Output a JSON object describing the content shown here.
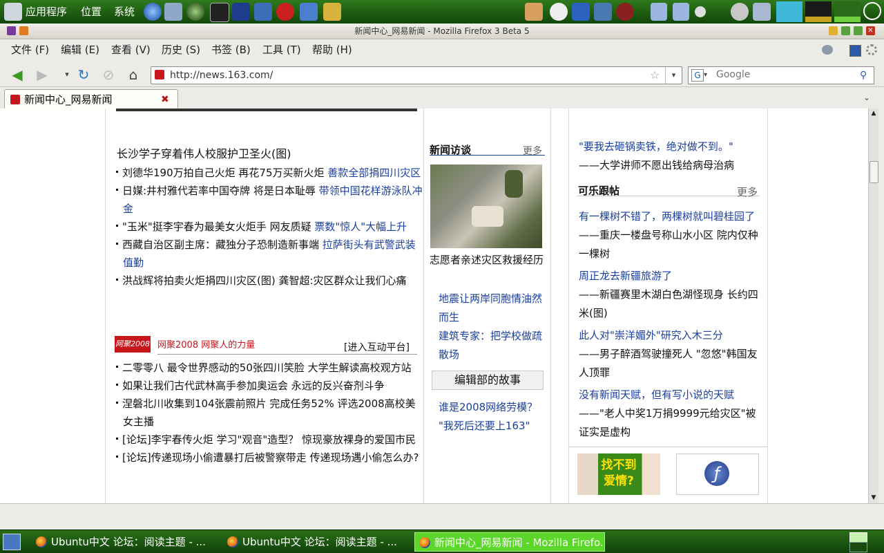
{
  "top_panel": {
    "menus": [
      "应用程序",
      "位置",
      "系统"
    ]
  },
  "window": {
    "title": "新闻中心_网易新闻 - Mozilla Firefox 3 Beta 5"
  },
  "menubar": [
    "文件 (F)",
    "编辑 (E)",
    "查看 (V)",
    "历史 (S)",
    "书签 (B)",
    "工具 (T)",
    "帮助 (H)"
  ],
  "navbar": {
    "url": "http://news.163.com/",
    "search_placeholder": "Google"
  },
  "tab": {
    "label": "新闻中心_网易新闻",
    "close": "✖"
  },
  "left_col": {
    "headline": "长沙学子穿着伟人校服护卫圣火(图)",
    "items": [
      {
        "text": "刘德华190万拍自己火炬 再花75万买新火炬 ",
        "link": "善款全部捐四川灾区"
      },
      {
        "text": "日媒:井村雅代若率中国夺牌 将是日本耻辱 ",
        "link": "带领中国花样游泳队冲金"
      },
      {
        "text": "\"玉米\"挺李宇春为最美女火炬手 网友质疑 ",
        "link": "票数\"惊人\"大幅上升"
      },
      {
        "text": "西藏自治区副主席：藏独分子恐制造新事端 ",
        "link": "拉萨街头有武警武装值勤"
      },
      {
        "text": "洪战辉将拍卖火炬捐四川灾区(图) 龚智超:灾区群众让我们心痛",
        "link": ""
      }
    ],
    "banner_logo": "网聚2008",
    "banner_text": "网聚2008  网聚人的力量",
    "banner_link": "[进入互动平台]",
    "items2": [
      "二零零八 最令世界感动的50张四川笑脸 大学生解读高校观方站",
      "如果让我们古代武林高手参加奥运会 永远的反兴奋剂斗争",
      "涅磐北川收集到104张震前照片 完成任务52% 评选2008高校美女主播",
      "[论坛]李宇春传火炬 学习\"观音\"造型？ 惊现豪放裸身的爱国市民",
      "[论坛]传递现场小偷遭暴打后被警察带走 传递现场遇小偷怎么办?"
    ]
  },
  "mid_col": {
    "title": "新闻访谈",
    "more": "更多",
    "photo_caption": "志愿者亲述灾区救援经历",
    "links": [
      "地震让两岸同胞情油然而生",
      "建筑专家：把学校做疏散场"
    ],
    "button": "编辑部的故事",
    "links2": [
      "谁是2008网络劳模？",
      "\"我死后还要上163\""
    ]
  },
  "right_col": {
    "quote": "\"要我去砸锅卖铁，绝对做不到。\"",
    "quote_sub": "——大学讲师不愿出钱给病母治病",
    "section": "可乐跟帖",
    "more": "更多",
    "entries": [
      {
        "link": "有一棵树不错了，两棵树就叫碧桂园了",
        "sub": "——重庆一楼盘号称山水小区 院内仅种一棵树"
      },
      {
        "link": "周正龙去新疆旅游了",
        "sub": "——新疆赛里木湖白色湖怪现身 长约四米(图)"
      },
      {
        "link": "此人对\"崇洋媚外\"研究入木三分",
        "sub": "——男子醉酒驾驶撞死人 \"忽悠\"韩国友人顶罪"
      },
      {
        "link": "没有新闻天赋，但有写小说的天赋",
        "sub": "——\"老人中奖1万捐9999元给灾区\"被证实是虚构"
      }
    ],
    "ad_text": "找不到爱情?"
  },
  "taskbar": [
    {
      "label": "Ubuntu中文 论坛：阅读主题 - ...",
      "active": false
    },
    {
      "label": "Ubuntu中文 论坛：阅读主题 - ...",
      "active": false
    },
    {
      "label": "新闻中心_网易新闻 - Mozilla Firefo...",
      "active": true
    }
  ],
  "colors": {
    "panel_green": "#1d5a10",
    "link_blue": "#1a3fa1",
    "netease_red": "#c8161d"
  }
}
